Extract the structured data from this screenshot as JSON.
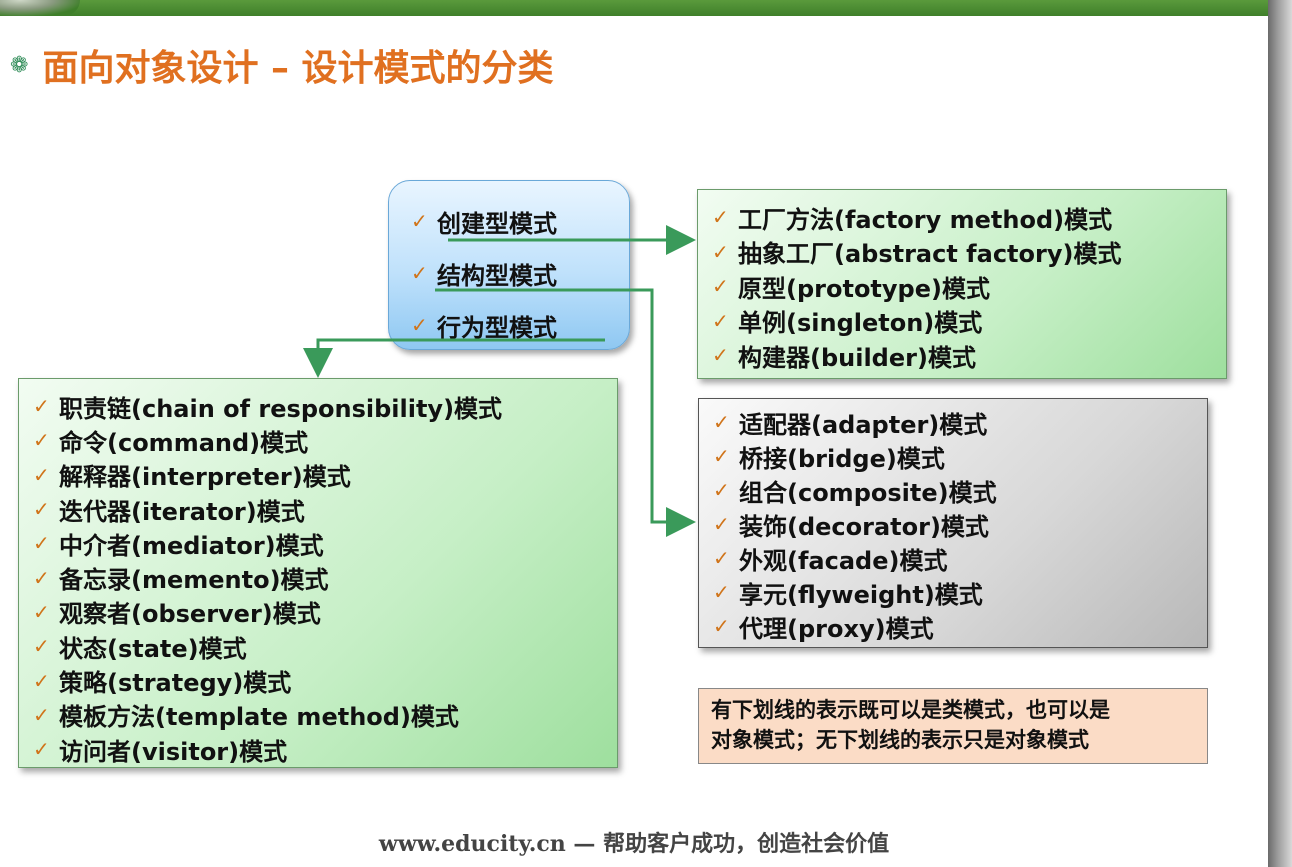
{
  "title": "面向对象设计 – 设计模式的分类",
  "categories": [
    "创建型模式",
    "结构型模式",
    "行为型模式"
  ],
  "creational": [
    "工厂方法(factory method)模式",
    "抽象工厂(abstract factory)模式",
    "原型(prototype)模式",
    "单例(singleton)模式",
    "构建器(builder)模式"
  ],
  "structural": [
    "适配器(adapter)模式",
    "桥接(bridge)模式",
    "组合(composite)模式",
    "装饰(decorator)模式",
    "外观(facade)模式",
    "享元(flyweight)模式",
    "代理(proxy)模式"
  ],
  "behavioral": [
    "职责链(chain of responsibility)模式",
    "命令(command)模式",
    "解释器(interpreter)模式",
    "迭代器(iterator)模式",
    "中介者(mediator)模式",
    "备忘录(memento)模式",
    "观察者(observer)模式",
    "状态(state)模式",
    "策略(strategy)模式",
    "模板方法(template method)模式",
    "访问者(visitor)模式"
  ],
  "note": {
    "line1": "有下划线的表示既可以是类模式，也可以是",
    "line2": "对象模式；无下划线的表示只是对象模式"
  },
  "footer": "www.educity.cn — 帮助客户成功，创造社会价值",
  "colors": {
    "title": "#e07020",
    "arrow": "#3a9a5a",
    "check": "#d0741a"
  }
}
